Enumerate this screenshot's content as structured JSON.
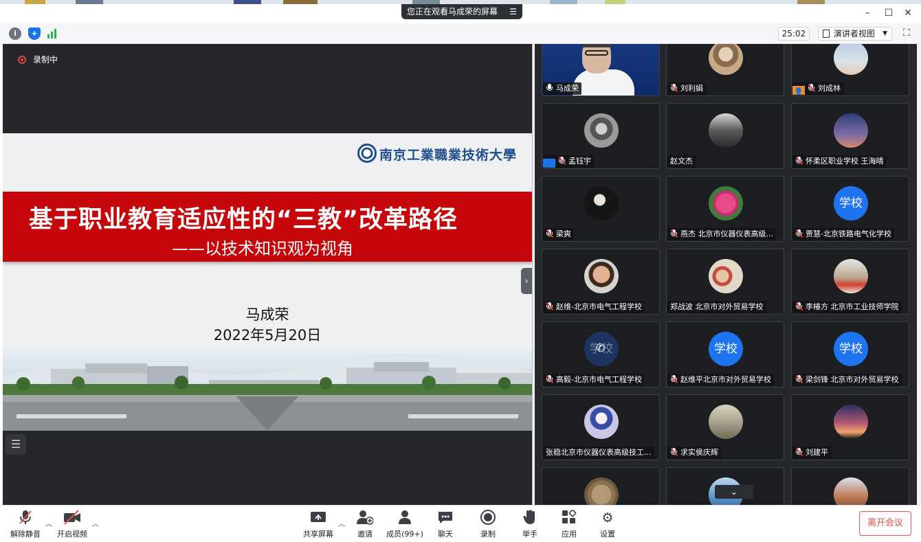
{
  "window": {
    "share_banner": "您正在观看马成荣的屏幕",
    "timer": "25:02",
    "view_mode": "演讲者视图"
  },
  "recording_label": "录制中",
  "slide": {
    "school_logo": "南京工業職業技術大學",
    "title": "基于职业教育适应性的“三教”改革路径",
    "subtitle": "——以技术知识观为视角",
    "author": "马成荣",
    "date": "2022年5月20日"
  },
  "participants": [
    {
      "name": "马成荣",
      "mic": "on",
      "avatar": "video"
    },
    {
      "name": "刘利娟",
      "mic": "muted",
      "avatar": "photo-dog"
    },
    {
      "name": "刘成林",
      "mic": "muted",
      "avatar": "photo-sky",
      "host_icon": true
    },
    {
      "name": "孟钰宇",
      "mic": "muted",
      "avatar": "photo-bw",
      "host_icon_blue": true
    },
    {
      "name": "赵文杰",
      "mic": "none",
      "avatar": "photo-group"
    },
    {
      "name": "怀柔区职业学校 王海晴",
      "mic": "muted",
      "avatar": "photo-cactus"
    },
    {
      "name": "梁爽",
      "mic": "muted",
      "avatar": "photo-dark"
    },
    {
      "name": "燕杰 北京市仪器仪表高级...",
      "mic": "muted",
      "avatar": "photo-flower"
    },
    {
      "name": "贾慧-北京铁路电气化学校",
      "mic": "muted",
      "avatar": "school",
      "avatar_text": "学校"
    },
    {
      "name": "赵维-北京市电气工程学校",
      "mic": "muted",
      "avatar": "photo-man"
    },
    {
      "name": "郑战波 北京市对外贸易学校",
      "mic": "none",
      "avatar": "photo-kids"
    },
    {
      "name": "李椿方 北京市工业技师学院",
      "mic": "muted",
      "avatar": "photo-beach"
    },
    {
      "name": "高毅-北京市电气工程学校",
      "mic": "muted",
      "avatar": "school-phone",
      "avatar_text": "学校"
    },
    {
      "name": "赵维平北京市对外贸易学校",
      "mic": "muted",
      "avatar": "school",
      "avatar_text": "学校"
    },
    {
      "name": "梁剑锋 北京市对外贸易学校",
      "mic": "muted",
      "avatar": "school",
      "avatar_text": "学校"
    },
    {
      "name": "张稳北京市仪器仪表高级技工...",
      "mic": "none",
      "avatar": "photo-art"
    },
    {
      "name": "求实侯庆辉",
      "mic": "muted",
      "avatar": "photo-girl"
    },
    {
      "name": "刘建平",
      "mic": "muted",
      "avatar": "photo-sunset"
    },
    {
      "name": "",
      "mic": "none",
      "avatar": "photo-coin"
    },
    {
      "name": "",
      "mic": "none",
      "avatar": "photo-lake"
    },
    {
      "name": "",
      "mic": "none",
      "avatar": "photo-canyon"
    }
  ],
  "toolbar": {
    "unmute": "解除静音",
    "start_video": "开启视频",
    "share_screen": "共享屏幕",
    "invite": "邀请",
    "participants": "成员(99+)",
    "chat": "聊天",
    "record": "录制",
    "raise_hand": "举手",
    "apps": "应用",
    "settings": "设置",
    "leave": "离开会议"
  },
  "colors": {
    "banner_red": "#c5070b",
    "school_blue": "#1e74f0",
    "leave_red": "#e5534b",
    "stage_dark": "#25272b"
  }
}
